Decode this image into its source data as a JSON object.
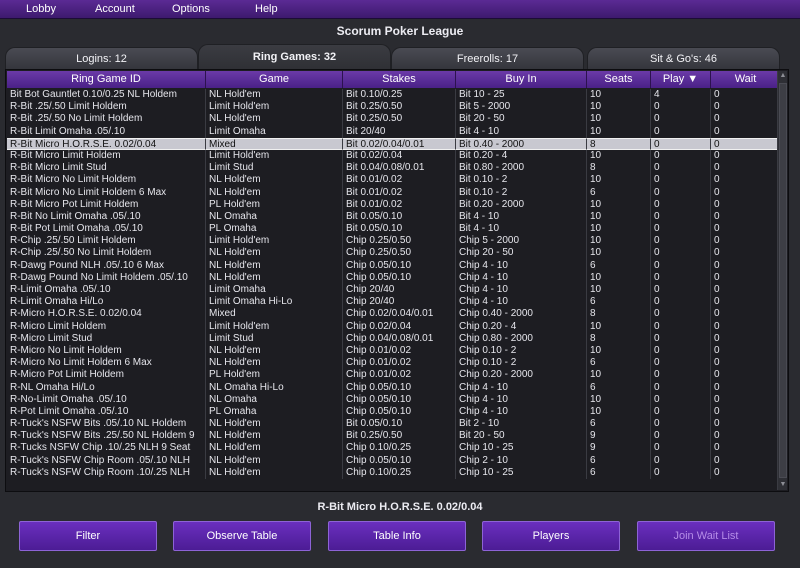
{
  "menu": [
    "Lobby",
    "Account",
    "Options",
    "Help"
  ],
  "title": "Scorum Poker League",
  "tabs": [
    {
      "label": "Logins: 12",
      "active": false
    },
    {
      "label": "Ring Games: 32",
      "active": true
    },
    {
      "label": "Freerolls: 17",
      "active": false
    },
    {
      "label": "Sit & Go's: 46",
      "active": false
    }
  ],
  "table": {
    "headers": [
      "Ring Game ID",
      "Game",
      "Stakes",
      "Buy In",
      "Seats",
      "Play ▼",
      "Wait"
    ],
    "rows": [
      [
        "Bit Bot Gauntlet 0.10/0.25 NL Holdem",
        "NL Hold'em",
        "Bit 0.10/0.25",
        "Bit 10 - 25",
        "10",
        "4",
        "0"
      ],
      [
        "R-Bit .25/.50 Limit Holdem",
        "Limit Hold'em",
        "Bit 0.25/0.50",
        "Bit 5 - 2000",
        "10",
        "0",
        "0"
      ],
      [
        "R-Bit .25/.50 No Limit Holdem",
        "NL Hold'em",
        "Bit 0.25/0.50",
        "Bit 20 - 50",
        "10",
        "0",
        "0"
      ],
      [
        "R-Bit Limit Omaha .05/.10",
        "Limit Omaha",
        "Bit 20/40",
        "Bit 4 - 10",
        "10",
        "0",
        "0"
      ],
      [
        "R-Bit Micro H.O.R.S.E. 0.02/0.04",
        "Mixed",
        "Bit 0.02/0.04/0.01",
        "Bit 0.40 - 2000",
        "8",
        "0",
        "0"
      ],
      [
        "R-Bit Micro Limit Holdem",
        "Limit Hold'em",
        "Bit 0.02/0.04",
        "Bit 0.20 - 4",
        "10",
        "0",
        "0"
      ],
      [
        "R-Bit Micro Limit Stud",
        "Limit Stud",
        "Bit 0.04/0.08/0.01",
        "Bit 0.80 - 2000",
        "8",
        "0",
        "0"
      ],
      [
        "R-Bit Micro No Limit Holdem",
        "NL Hold'em",
        "Bit 0.01/0.02",
        "Bit 0.10 - 2",
        "10",
        "0",
        "0"
      ],
      [
        "R-Bit Micro No Limit Holdem 6 Max",
        "NL Hold'em",
        "Bit 0.01/0.02",
        "Bit 0.10 - 2",
        "6",
        "0",
        "0"
      ],
      [
        "R-Bit Micro Pot Limit Holdem",
        "PL Hold'em",
        "Bit 0.01/0.02",
        "Bit 0.20 - 2000",
        "10",
        "0",
        "0"
      ],
      [
        "R-Bit No Limit Omaha .05/.10",
        "NL Omaha",
        "Bit 0.05/0.10",
        "Bit 4 - 10",
        "10",
        "0",
        "0"
      ],
      [
        "R-Bit Pot Limit Omaha .05/.10",
        "PL Omaha",
        "Bit 0.05/0.10",
        "Bit 4 - 10",
        "10",
        "0",
        "0"
      ],
      [
        "R-Chip .25/.50 Limit Holdem",
        "Limit Hold'em",
        "Chip 0.25/0.50",
        "Chip 5 - 2000",
        "10",
        "0",
        "0"
      ],
      [
        "R-Chip .25/.50 No Limit Holdem",
        "NL Hold'em",
        "Chip 0.25/0.50",
        "Chip 20 - 50",
        "10",
        "0",
        "0"
      ],
      [
        "R-Dawg Pound NLH .05/.10 6 Max",
        "NL Hold'em",
        "Chip 0.05/0.10",
        "Chip 4 - 10",
        "6",
        "0",
        "0"
      ],
      [
        "R-Dawg Pound No Limit Holdem .05/.10",
        "NL Hold'em",
        "Chip 0.05/0.10",
        "Chip 4 - 10",
        "10",
        "0",
        "0"
      ],
      [
        "R-Limit Omaha .05/.10",
        "Limit Omaha",
        "Chip 20/40",
        "Chip 4 - 10",
        "10",
        "0",
        "0"
      ],
      [
        "R-Limit Omaha Hi/Lo",
        "Limit Omaha Hi-Lo",
        "Chip 20/40",
        "Chip 4 - 10",
        "6",
        "0",
        "0"
      ],
      [
        "R-Micro H.O.R.S.E. 0.02/0.04",
        "Mixed",
        "Chip 0.02/0.04/0.01",
        "Chip 0.40 - 2000",
        "8",
        "0",
        "0"
      ],
      [
        "R-Micro Limit Holdem",
        "Limit Hold'em",
        "Chip 0.02/0.04",
        "Chip 0.20 - 4",
        "10",
        "0",
        "0"
      ],
      [
        "R-Micro Limit Stud",
        "Limit Stud",
        "Chip 0.04/0.08/0.01",
        "Chip 0.80 - 2000",
        "8",
        "0",
        "0"
      ],
      [
        "R-Micro No Limit Holdem",
        "NL Hold'em",
        "Chip 0.01/0.02",
        "Chip 0.10 - 2",
        "10",
        "0",
        "0"
      ],
      [
        "R-Micro No Limit Holdem 6 Max",
        "NL Hold'em",
        "Chip 0.01/0.02",
        "Chip 0.10 - 2",
        "6",
        "0",
        "0"
      ],
      [
        "R-Micro Pot Limit Holdem",
        "PL Hold'em",
        "Chip 0.01/0.02",
        "Chip 0.20 - 2000",
        "10",
        "0",
        "0"
      ],
      [
        "R-NL Omaha Hi/Lo",
        "NL Omaha Hi-Lo",
        "Chip 0.05/0.10",
        "Chip 4 - 10",
        "6",
        "0",
        "0"
      ],
      [
        "R-No-Limit Omaha .05/.10",
        "NL Omaha",
        "Chip 0.05/0.10",
        "Chip 4 - 10",
        "10",
        "0",
        "0"
      ],
      [
        "R-Pot Limit Omaha .05/.10",
        "PL Omaha",
        "Chip 0.05/0.10",
        "Chip 4 - 10",
        "10",
        "0",
        "0"
      ],
      [
        "R-Tuck's NSFW Bits .05/.10 NL Holdem",
        "NL Hold'em",
        "Bit 0.05/0.10",
        "Bit 2 - 10",
        "6",
        "0",
        "0"
      ],
      [
        "R-Tuck's NSFW Bits .25/.50 NL Holdem 9",
        "NL Hold'em",
        "Bit 0.25/0.50",
        "Bit 20 - 50",
        "9",
        "0",
        "0"
      ],
      [
        "R-Tucks NSFW Chip .10/.25 NLH 9 Seat",
        "NL Hold'em",
        "Chip 0.10/0.25",
        "Chip 10 - 25",
        "9",
        "0",
        "0"
      ],
      [
        "R-Tuck's NSFW Chip Room .05/.10 NLH",
        "NL Hold'em",
        "Chip 0.05/0.10",
        "Chip 2 - 10",
        "6",
        "0",
        "0"
      ],
      [
        "R-Tuck's NSFW Chip Room .10/.25 NLH",
        "NL Hold'em",
        "Chip 0.10/0.25",
        "Chip 10 - 25",
        "6",
        "0",
        "0"
      ]
    ],
    "selected_index": 4
  },
  "selected_game": "R-Bit Micro H.O.R.S.E. 0.02/0.04",
  "buttons": [
    "Filter",
    "Observe Table",
    "Table Info",
    "Players",
    "Join Wait List"
  ],
  "colors": {
    "accent": "#5b2a94",
    "header": "#6b3aa8",
    "selected_row": "#c8c8d0"
  }
}
